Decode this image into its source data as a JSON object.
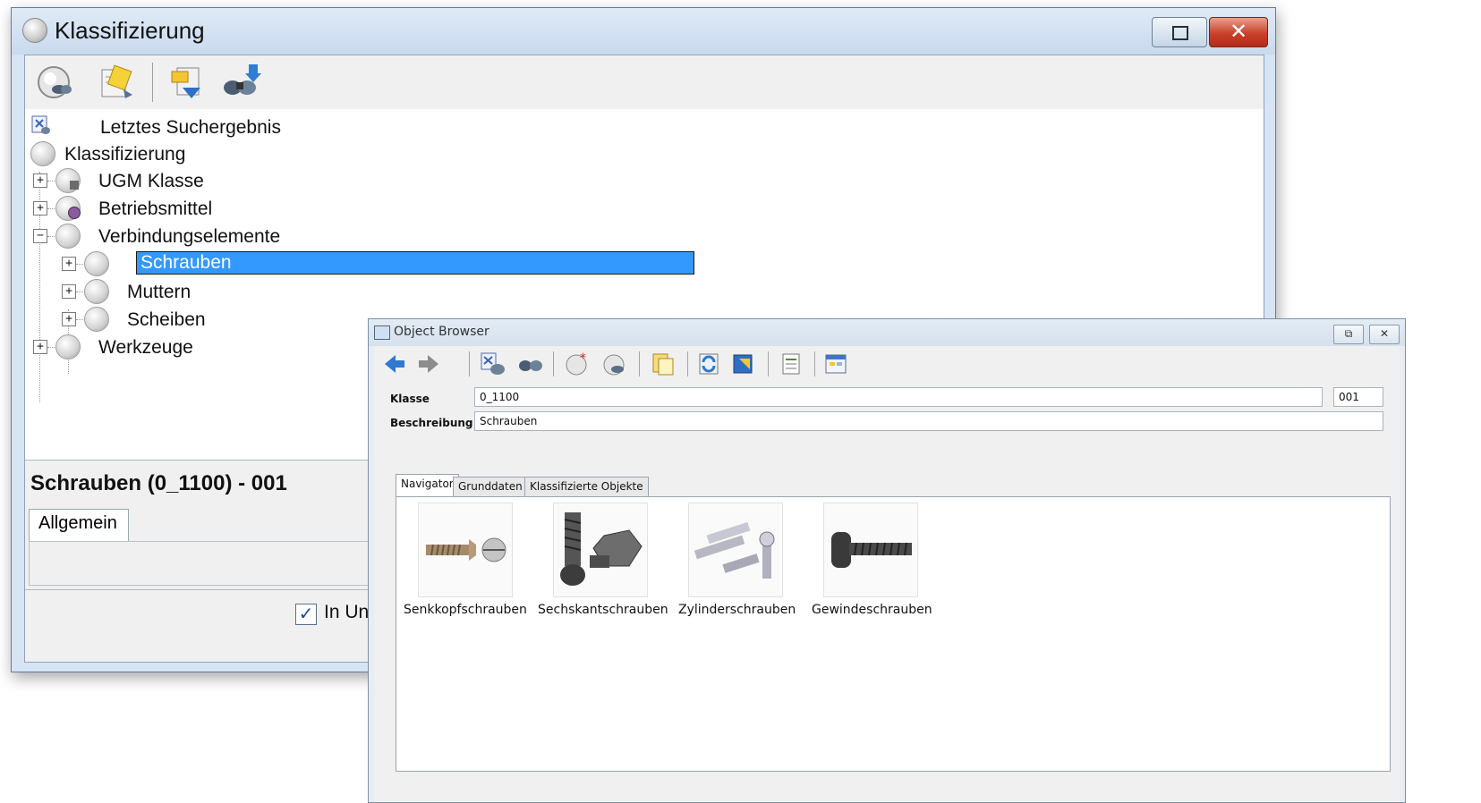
{
  "main_window": {
    "title": "Klassifizierung",
    "close_symbol": "✕",
    "toolbar_icons": [
      "search-icon",
      "edit-note-icon",
      "import-icon",
      "binoculars-search-icon"
    ],
    "tree": {
      "last_result": "Letztes Suchergebnis",
      "root": "Klassifizierung",
      "items": [
        {
          "label": "UGM Klasse",
          "expander": "+"
        },
        {
          "label": "Betriebsmittel",
          "expander": "+"
        },
        {
          "label": "Verbindungselemente",
          "expander": "−"
        },
        {
          "label": "Schrauben",
          "expander": "+",
          "selected": true
        },
        {
          "label": "Muttern",
          "expander": "+"
        },
        {
          "label": "Scheiben",
          "expander": "+"
        },
        {
          "label": "Werkzeuge",
          "expander": "+"
        }
      ]
    },
    "detail": {
      "heading": "Schrauben (0_1100)  - 001",
      "tab": "Allgemein",
      "checkbox_label": "In Un",
      "checkbox_checked": true
    }
  },
  "object_browser": {
    "title": "Object Browser",
    "restore_symbol": "⧉",
    "close_symbol": "✕",
    "fields": {
      "klasse_label": "Klasse",
      "klasse_value": "0_1100",
      "klasse_suffix": "001",
      "beschreibung_label": "Beschreibung",
      "beschreibung_value": "Schrauben"
    },
    "tabs": [
      "Navigator",
      "Grunddaten",
      "Klassifizierte Objekte"
    ],
    "active_tab": "Navigator",
    "items": [
      {
        "label": "Senkkopfschrauben"
      },
      {
        "label": "Sechskantschrauben"
      },
      {
        "label": "Zylinderschrauben"
      },
      {
        "label": "Gewindeschrauben"
      }
    ]
  },
  "colors": {
    "selection": "#3399ff",
    "close_button": "#c9412a"
  }
}
